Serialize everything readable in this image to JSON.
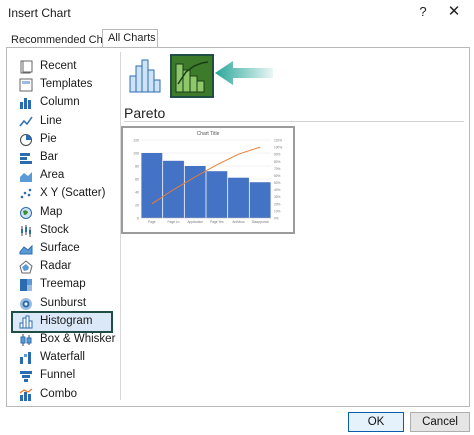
{
  "window": {
    "title": "Insert Chart",
    "help_label": "?",
    "close_label": "✕"
  },
  "tabs": [
    {
      "label": "Recommended Charts",
      "active": false
    },
    {
      "label": "All Charts",
      "active": true
    }
  ],
  "sidebar": {
    "items": [
      {
        "label": "Recent",
        "icon": "recent-icon"
      },
      {
        "label": "Templates",
        "icon": "templates-icon"
      },
      {
        "label": "Column",
        "icon": "column-chart-icon"
      },
      {
        "label": "Line",
        "icon": "line-chart-icon"
      },
      {
        "label": "Pie",
        "icon": "pie-chart-icon"
      },
      {
        "label": "Bar",
        "icon": "bar-chart-icon"
      },
      {
        "label": "Area",
        "icon": "area-chart-icon"
      },
      {
        "label": "X Y (Scatter)",
        "icon": "scatter-chart-icon"
      },
      {
        "label": "Map",
        "icon": "map-chart-icon"
      },
      {
        "label": "Stock",
        "icon": "stock-chart-icon"
      },
      {
        "label": "Surface",
        "icon": "surface-chart-icon"
      },
      {
        "label": "Radar",
        "icon": "radar-chart-icon"
      },
      {
        "label": "Treemap",
        "icon": "treemap-chart-icon"
      },
      {
        "label": "Sunburst",
        "icon": "sunburst-chart-icon"
      },
      {
        "label": "Histogram",
        "icon": "histogram-chart-icon",
        "selected": true
      },
      {
        "label": "Box & Whisker",
        "icon": "box-whisker-chart-icon"
      },
      {
        "label": "Waterfall",
        "icon": "waterfall-chart-icon"
      },
      {
        "label": "Funnel",
        "icon": "funnel-chart-icon"
      },
      {
        "label": "Combo",
        "icon": "combo-chart-icon"
      }
    ]
  },
  "main": {
    "subtypes": [
      {
        "name": "Histogram",
        "icon": "histogram-subtype-icon",
        "selected": false
      },
      {
        "name": "Pareto",
        "icon": "pareto-subtype-icon",
        "selected": true
      }
    ],
    "selected_title": "Pareto",
    "preview": {
      "title": "Chart Title",
      "chart_data": {
        "type": "bar",
        "title": "Chart Title",
        "categories": [
          "Page",
          "Page Ln",
          "Application",
          "Page Yes",
          "Antivirus",
          "Disapproval"
        ],
        "values": [
          100,
          88,
          80,
          72,
          62,
          55
        ],
        "line_values": [
          20,
          40,
          58,
          75,
          90,
          100
        ],
        "ylim": [
          0,
          120
        ],
        "y_ticks": [
          "0",
          "20",
          "40",
          "60",
          "80",
          "100",
          "120"
        ],
        "y2_ticks": [
          "0%",
          "10%",
          "20%",
          "30%",
          "40%",
          "50%",
          "60%",
          "70%",
          "80%",
          "90%",
          "100%",
          "110%"
        ]
      }
    }
  },
  "accent": {
    "bar": "#4472c4",
    "line": "#ed7d31",
    "highlight": "#1f4e46",
    "arrow": "#2aa79b"
  },
  "footer": {
    "ok_label": "OK",
    "cancel_label": "Cancel"
  }
}
